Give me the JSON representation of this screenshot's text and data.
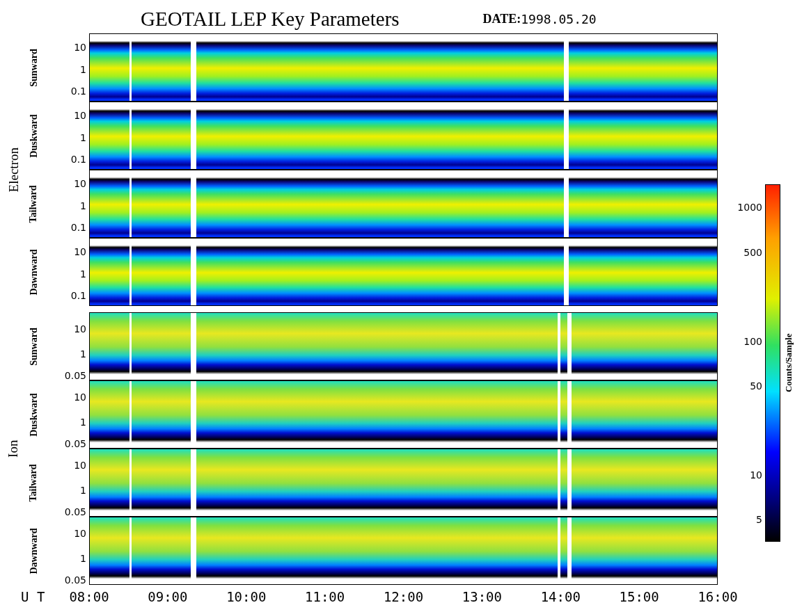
{
  "title": "GEOTAIL LEP Key Parameters",
  "date": {
    "label": "DATE:",
    "value": "1998.05.20"
  },
  "groups": [
    {
      "name": "Electron",
      "kind": "electron",
      "panels": [
        {
          "label": "Sunward",
          "y_ticks": [
            "10",
            "1",
            "0.1"
          ]
        },
        {
          "label": "Duskward",
          "y_ticks": [
            "10",
            "1",
            "0.1"
          ]
        },
        {
          "label": "Tailward",
          "y_ticks": [
            "10",
            "1",
            "0.1"
          ]
        },
        {
          "label": "Dawnward",
          "y_ticks": [
            "10",
            "1",
            "0.1"
          ]
        }
      ]
    },
    {
      "name": "Ion",
      "kind": "ion",
      "panels": [
        {
          "label": "Sunward",
          "y_ticks": [
            "10",
            "1",
            "0.05"
          ]
        },
        {
          "label": "Duskward",
          "y_ticks": [
            "10",
            "1",
            "0.05"
          ]
        },
        {
          "label": "Tailward",
          "y_ticks": [
            "10",
            "1",
            "0.05"
          ]
        },
        {
          "label": "Dawnward",
          "y_ticks": [
            "10",
            "1",
            "0.05"
          ]
        }
      ]
    }
  ],
  "x_axis": {
    "label": "U T",
    "ticks": [
      "08:00",
      "09:00",
      "10:00",
      "11:00",
      "12:00",
      "13:00",
      "14:00",
      "15:00",
      "16:00"
    ]
  },
  "colorbar": {
    "label": "Counts/Sample",
    "ticks": [
      "1000",
      "500",
      "100",
      "50",
      "10",
      "5"
    ]
  }
}
